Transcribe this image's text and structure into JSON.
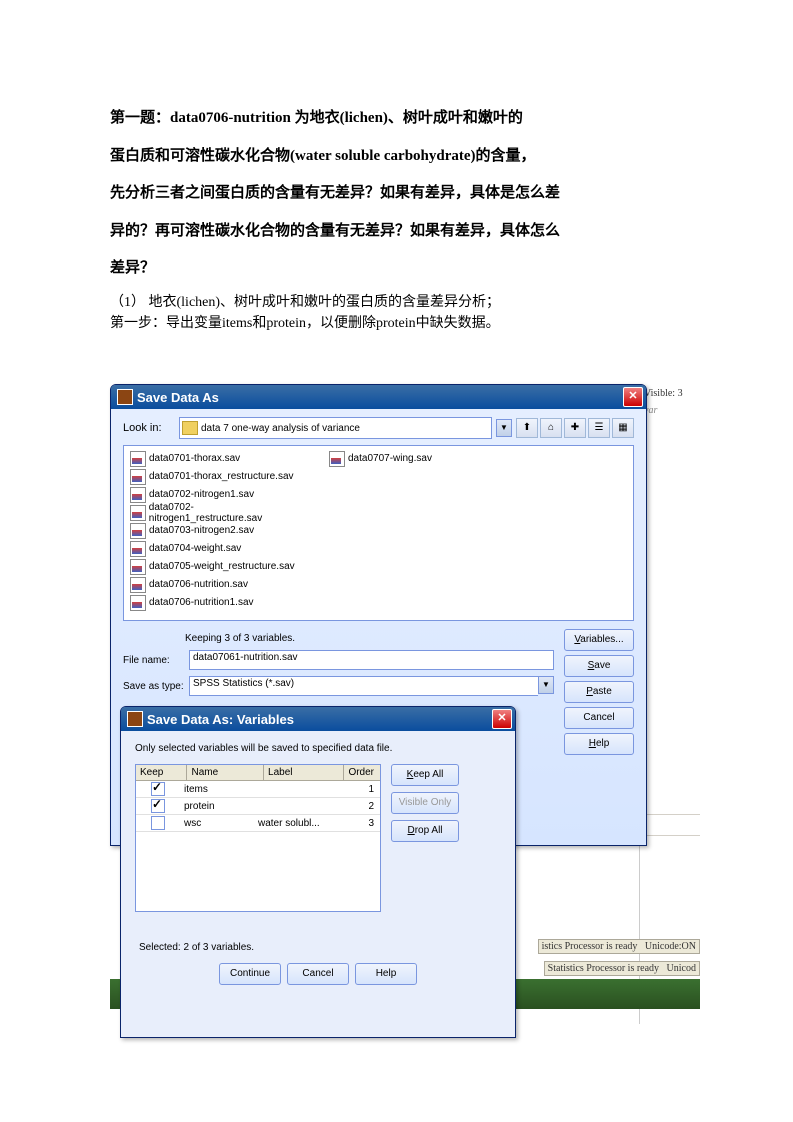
{
  "question": {
    "line1": "第一题：data0706-nutrition 为地衣(lichen)、树叶成叶和嫩叶的",
    "line2": "蛋白质和可溶性碳水化合物(water soluble carbohydrate)的含量，",
    "line3": "先分析三者之间蛋白质的含量有无差异？如果有差异，具体是怎么差",
    "line4": "异的？再可溶性碳水化合物的含量有无差异？如果有差异，具体怎么",
    "line5": "差异？"
  },
  "answer": {
    "line1": "（1） 地衣(lichen)、树叶成叶和嫩叶的蛋白质的含量差异分析；",
    "line2": "第一步：导出变量items和protein，以便删除protein中缺失数据。"
  },
  "peek": {
    "visible": "Visible: 3",
    "var": "var"
  },
  "saveDialog": {
    "title": "Save Data As",
    "lookin_label": "Look in:",
    "lookin_value": "data 7 one-way analysis of variance",
    "files": [
      "data0701-thorax.sav",
      "data0701-thorax_restructure.sav",
      "data0702-nitrogen1.sav",
      "data0702-nitrogen1_restructure.sav",
      "data0703-nitrogen2.sav",
      "data0704-weight.sav",
      "data0705-weight_restructure.sav",
      "data0706-nutrition.sav",
      "data0706-nutrition1.sav",
      "data0707-wing.sav"
    ],
    "keeping": "Keeping 3 of 3 variables.",
    "filename_label": "File name:",
    "filename_value": "data07061-nutrition.sav",
    "savetype_label": "Save as type:",
    "savetype_value": "SPSS Statistics (*.sav)",
    "buttons": {
      "variables": "Variables...",
      "save": "Save",
      "paste": "Paste",
      "cancel": "Cancel",
      "help": "Help"
    }
  },
  "varsDialog": {
    "title": "Save Data As: Variables",
    "info": "Only selected variables will be saved to specified data file.",
    "headers": {
      "keep": "Keep",
      "name": "Name",
      "label": "Label",
      "order": "Order"
    },
    "rows": [
      {
        "keep": true,
        "name": "items",
        "label": "",
        "order": "1"
      },
      {
        "keep": true,
        "name": "protein",
        "label": "",
        "order": "2"
      },
      {
        "keep": false,
        "name": "wsc",
        "label": "water solubl...",
        "order": "3"
      }
    ],
    "side": {
      "keepall": "Keep All",
      "visibleonly": "Visible Only",
      "dropall": "Drop All"
    },
    "selected": "Selected: 2 of 3 variables.",
    "bottom": {
      "continue": "Continue",
      "cancel": "Cancel",
      "help": "Help"
    }
  },
  "statusbar": {
    "text1": "istics Processor is ready",
    "unicode1": "Unicode:ON",
    "text2": "Statistics Processor is ready",
    "unicode2": "Unicod"
  }
}
